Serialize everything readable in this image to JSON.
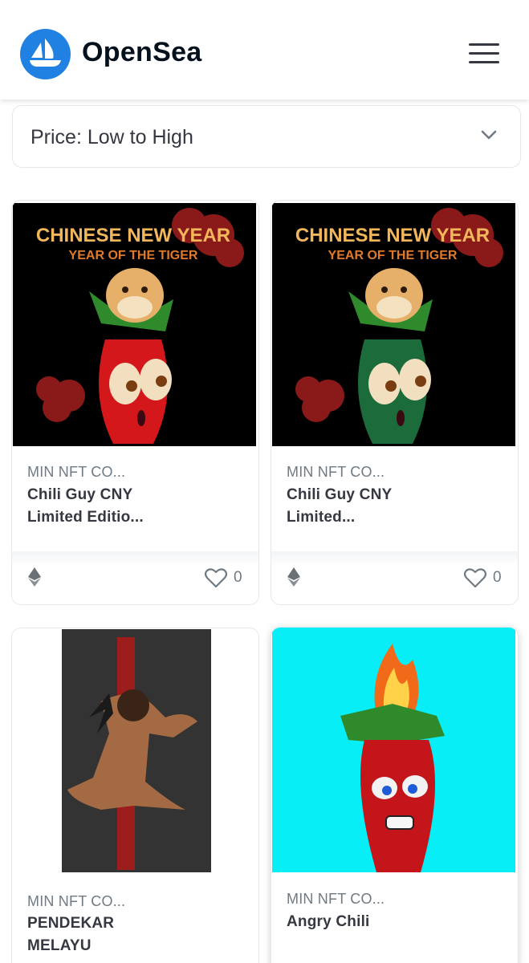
{
  "header": {
    "brand": "OpenSea",
    "logo_icon": "opensea-boat-logo",
    "menu_icon": "hamburger-menu-icon"
  },
  "sort": {
    "selected": "Price: Low to High",
    "icon": "chevron-down-icon"
  },
  "colors": {
    "accent": "#2081e2",
    "text": "#04111d",
    "muted": "#707a83",
    "border": "#e5e8eb"
  },
  "items": [
    {
      "collection": "MIN NFT CO...",
      "title_line1": "Chili Guy CNY",
      "title_line2": "Limited Editio...",
      "likes": "0",
      "art_text1": "CHINESE NEW YEAR",
      "art_text2": "YEAR OF THE TIGER"
    },
    {
      "collection": "MIN NFT CO...",
      "title_line1": "Chili Guy CNY",
      "title_line2": "Limited...",
      "likes": "0",
      "art_text1": "CHINESE NEW YEAR",
      "art_text2": "YEAR OF THE TIGER"
    },
    {
      "collection": "MIN NFT CO...",
      "title_line1": "PENDEKAR",
      "title_line2": "MELAYU"
    },
    {
      "collection": "MIN NFT CO...",
      "title_line1": "Angry Chili"
    }
  ]
}
